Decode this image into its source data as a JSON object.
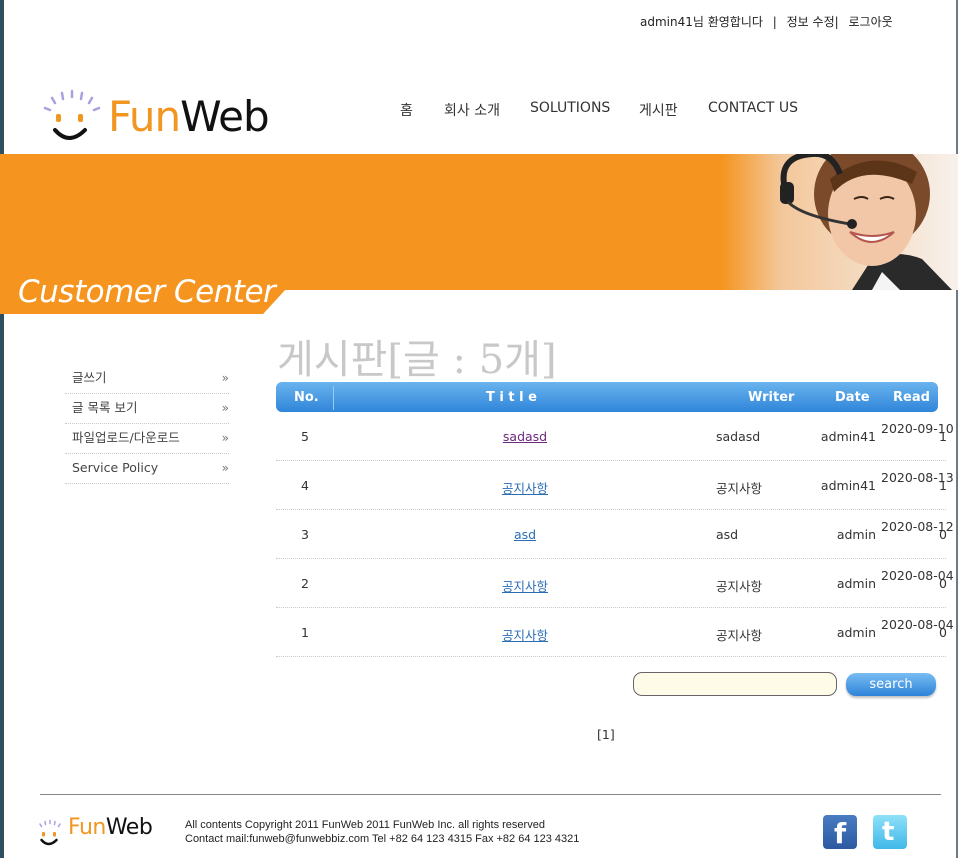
{
  "header": {
    "welcome": "admin41님  환영합니다",
    "sep": "|",
    "edit_info": "정보 수정",
    "sep2": "|",
    "logout": "로그아웃",
    "logo_fun": "Fun",
    "logo_web": "Web"
  },
  "nav": {
    "items": [
      {
        "label": "홈"
      },
      {
        "label": "회사 소개"
      },
      {
        "label": "SOLUTIONS"
      },
      {
        "label": "게시판"
      },
      {
        "label": "CONTACT US"
      }
    ]
  },
  "banner": {
    "title": "Customer Center"
  },
  "page": {
    "title": "게시판[글 : 5개]"
  },
  "sidebar": {
    "items": [
      {
        "label": "글쓰기",
        "arrow": "»"
      },
      {
        "label": "글 목록 보기",
        "arrow": "»"
      },
      {
        "label": "파일업로드/다운로드",
        "arrow": "»"
      },
      {
        "label": "Service Policy",
        "arrow": "»"
      }
    ]
  },
  "board": {
    "columns": {
      "no": "No.",
      "title": "T i t l e",
      "writer": "Writer",
      "date": "Date",
      "read": "Read"
    },
    "rows": [
      {
        "no": "5",
        "title": "sadasd",
        "writer": "sadasd",
        "user": "admin41",
        "date": "2020-09-10",
        "read": "1"
      },
      {
        "no": "4",
        "title": "공지사항",
        "writer": "공지사항",
        "user": "admin41",
        "date": "2020-08-13",
        "read": "1"
      },
      {
        "no": "3",
        "title": "asd",
        "writer": "asd",
        "user": "admin",
        "date": "2020-08-12",
        "read": "0"
      },
      {
        "no": "2",
        "title": "공지사항",
        "writer": "공지사항",
        "user": "admin",
        "date": "2020-08-04",
        "read": "0"
      },
      {
        "no": "1",
        "title": "공지사항",
        "writer": "공지사항",
        "user": "admin",
        "date": "2020-08-04",
        "read": "0"
      }
    ]
  },
  "search": {
    "value": "",
    "button_label": "search"
  },
  "pager": {
    "label": "[1]"
  },
  "footer": {
    "logo_fun": "Fun",
    "logo_web": "Web",
    "copyright": "All contents Copyright 2011 FunWeb 2011 FunWeb Inc. all rights reserved",
    "contact": "Contact mail:funweb@funwebbiz.com Tel +82 64 123 4315 Fax +82 64 123 4321"
  },
  "colors": {
    "accent_orange": "#f5951f",
    "table_header_blue": "#2f85d9",
    "link_blue": "#2a6db5"
  }
}
